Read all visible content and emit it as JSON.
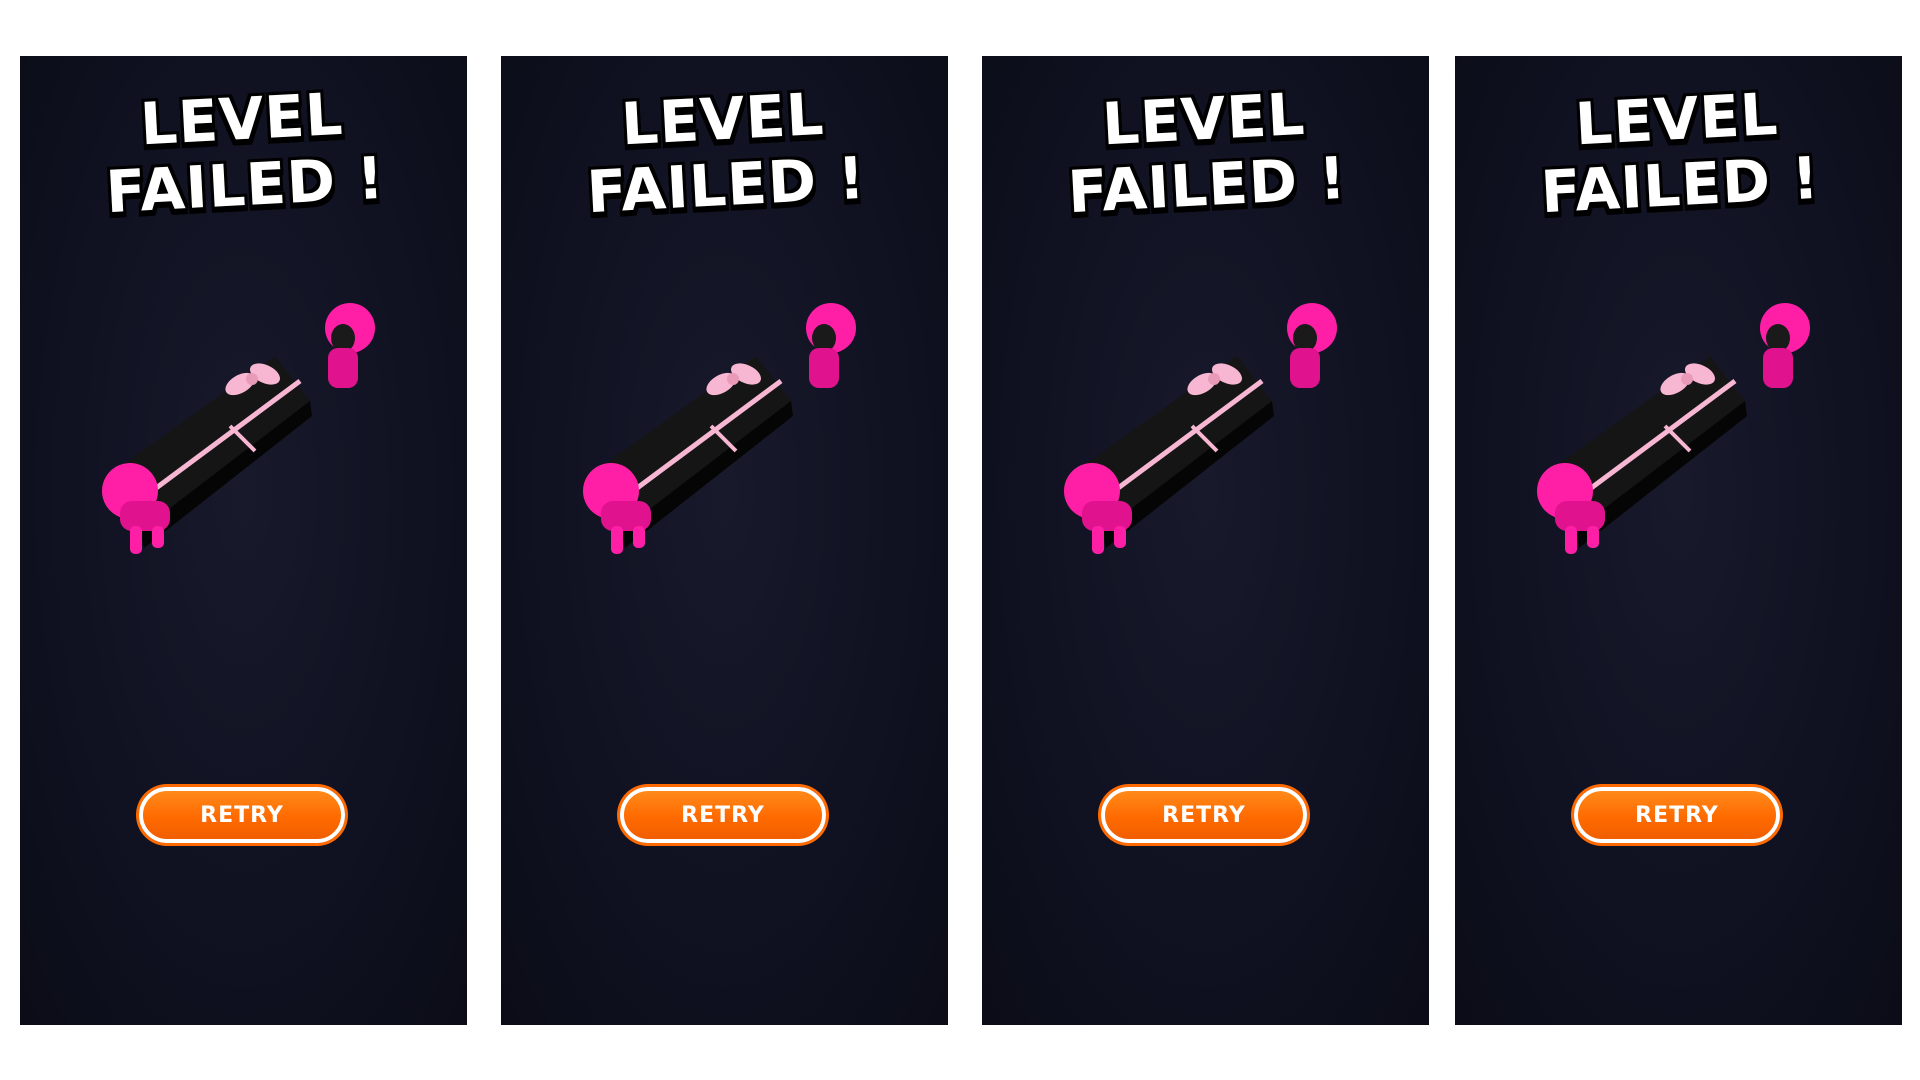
{
  "panels": [
    {
      "title_line1": "LEVEL",
      "title_line2": "FAILED !",
      "retry_label": "RETRY"
    },
    {
      "title_line1": "LEVEL",
      "title_line2": "FAILED !",
      "retry_label": "RETRY"
    },
    {
      "title_line1": "LEVEL",
      "title_line2": "FAILED !",
      "retry_label": "RETRY"
    },
    {
      "title_line1": "LEVEL",
      "title_line2": "FAILED !",
      "retry_label": "RETRY"
    }
  ],
  "colors": {
    "background": "#0e1020",
    "character": "#ff1fa6",
    "coffin": "#141414",
    "ribbon": "#f7b6d2",
    "button": "#ff6a00"
  },
  "icons": [
    "pink-guard-icon",
    "black-coffin-icon",
    "pink-bow-icon"
  ]
}
